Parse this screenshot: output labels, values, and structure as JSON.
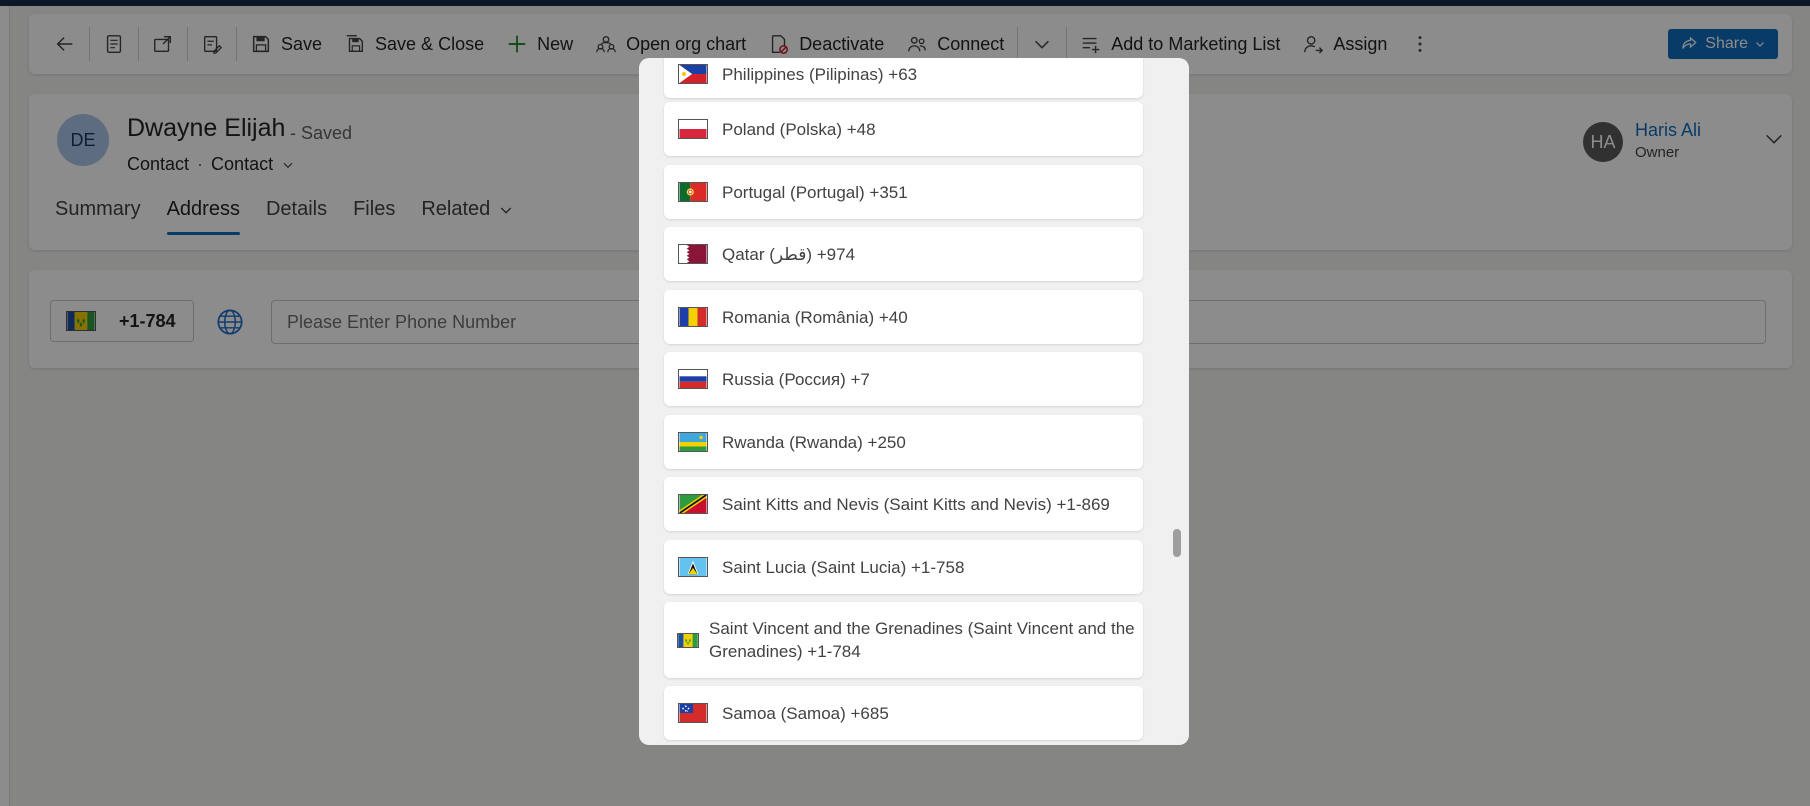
{
  "commandbar": {
    "save": "Save",
    "save_close": "Save & Close",
    "new": "New",
    "open_org_chart": "Open org chart",
    "deactivate": "Deactivate",
    "connect": "Connect",
    "add_marketing": "Add to Marketing List",
    "assign": "Assign",
    "share": "Share"
  },
  "record": {
    "initials": "DE",
    "name": "Dwayne Elijah",
    "status": "- Saved",
    "entity": "Contact",
    "form": "Contact",
    "owner_initials": "HA",
    "owner_name": "Haris Ali",
    "owner_label": "Owner"
  },
  "tabs": [
    "Summary",
    "Address",
    "Details",
    "Files",
    "Related"
  ],
  "phone": {
    "country_code": "+1-784",
    "placeholder": "Please Enter Phone Number"
  },
  "countries": [
    {
      "label": "Philippines (Pilipinas) +63",
      "flag": "philippines"
    },
    {
      "label": "Poland (Polska) +48",
      "flag": "poland"
    },
    {
      "label": "Portugal (Portugal) +351",
      "flag": "portugal"
    },
    {
      "label": "Qatar (قطر) +974",
      "flag": "qatar"
    },
    {
      "label": "Romania (România) +40",
      "flag": "romania"
    },
    {
      "label": "Russia (Россия) +7",
      "flag": "russia"
    },
    {
      "label": "Rwanda (Rwanda) +250",
      "flag": "rwanda"
    },
    {
      "label": "Saint Kitts and Nevis (Saint Kitts and Nevis) +1-869",
      "flag": "saint-kitts"
    },
    {
      "label": "Saint Lucia (Saint Lucia) +1-758",
      "flag": "saint-lucia"
    },
    {
      "label": "Saint Vincent and the Grenadines (Saint Vincent and the Grenadines) +1-784",
      "flag": "saint-vincent"
    },
    {
      "label": "Samoa (Samoa) +685",
      "flag": "samoa"
    }
  ],
  "colors": {
    "accent": "#0f6cbd"
  }
}
